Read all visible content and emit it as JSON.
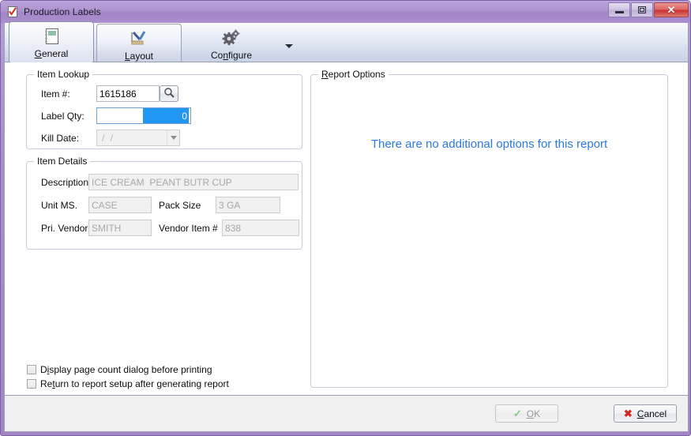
{
  "window": {
    "title": "Production Labels",
    "title_icon": "checked-document-icon",
    "controls": {
      "minimize": "minimize-icon",
      "restore": "restore-icon",
      "close": "close-icon",
      "close_glyph": "✕"
    }
  },
  "tabs": [
    {
      "id": "general",
      "label_pre": "",
      "label_accel": "G",
      "label_post": "eneral",
      "icon": "notebook-icon",
      "selected": true
    },
    {
      "id": "layout",
      "label_pre": "",
      "label_accel": "L",
      "label_post": "ayout",
      "icon": "ruler-pencil-icon",
      "selected": false
    },
    {
      "id": "configure",
      "label_pre": "Co",
      "label_accel": "n",
      "label_post": "figure",
      "icon": "gears-icon",
      "selected": false,
      "has_dropdown": true
    }
  ],
  "item_lookup": {
    "group_title": "Item Lookup",
    "item_number": {
      "label": "Item #:",
      "value": "1615186"
    },
    "search_button": {
      "icon": "magnifier-icon"
    },
    "label_qty": {
      "label": "Label Qty:",
      "value": "0",
      "selected": true
    },
    "kill_date": {
      "label": "Kill Date:",
      "value": "/  /",
      "disabled": true
    }
  },
  "item_details": {
    "group_title": "Item Details",
    "description": {
      "label": "Description:",
      "value": "ICE CREAM  PEANT BUTR CUP"
    },
    "unit_ms": {
      "label": "Unit MS.",
      "value": "CASE"
    },
    "pack_size": {
      "label": "Pack Size",
      "value": "3 GA"
    },
    "pri_vendor": {
      "label": "Pri. Vendor",
      "value": "SMITH"
    },
    "vendor_item": {
      "label": "Vendor Item #",
      "value": "838"
    }
  },
  "report_options": {
    "group_title_pre": "",
    "group_title_accel": "R",
    "group_title_post": "eport Options",
    "empty_message": "There are no additional options for this report",
    "empty_message_color": "#2a7ae0"
  },
  "checkboxes": [
    {
      "id": "display-page-count",
      "pre": "D",
      "accel": "i",
      "post": "splay page count dialog before printing",
      "checked": false
    },
    {
      "id": "return-to-setup",
      "pre": "Re",
      "accel": "t",
      "post": "urn to report setup after generating report",
      "checked": false
    }
  ],
  "footer": {
    "ok": {
      "pre": "",
      "accel": "O",
      "post": "K",
      "icon": "check-icon",
      "icon_glyph": "✓",
      "disabled": true
    },
    "cancel": {
      "pre": "",
      "accel": "C",
      "post": "ancel",
      "icon": "red-x-icon",
      "icon_glyph": "✖",
      "disabled": false
    }
  },
  "colors": {
    "titlebar": "#a88ccb",
    "accent_blue": "#2a7ae0",
    "selection_blue": "#2196f3",
    "close_red": "#c9322f"
  }
}
